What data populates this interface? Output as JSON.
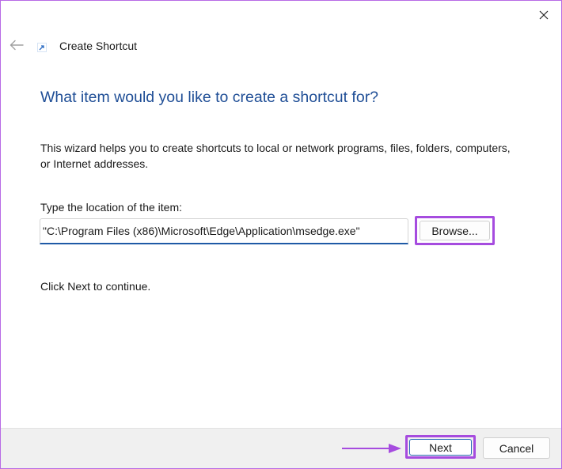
{
  "window": {
    "title": "Create Shortcut",
    "app_icon": "shortcut-icon",
    "close_icon": "close-icon",
    "back_icon": "back-arrow-icon"
  },
  "main": {
    "heading": "What item would you like to create a shortcut for?",
    "intro": "This wizard helps you to create shortcuts to local or network programs, files, folders, computers, or Internet addresses.",
    "location_label": "Type the location of the item:",
    "location_value": "\"C:\\Program Files (x86)\\Microsoft\\Edge\\Application\\msedge.exe\"",
    "browse_label": "Browse...",
    "continue_text": "Click Next to continue."
  },
  "footer": {
    "next_label": "Next",
    "cancel_label": "Cancel"
  },
  "colors": {
    "heading": "#1f4e96",
    "highlight": "#a64cdf",
    "window_border": "#b86ae6",
    "footer_bg": "#f0f0f0"
  }
}
